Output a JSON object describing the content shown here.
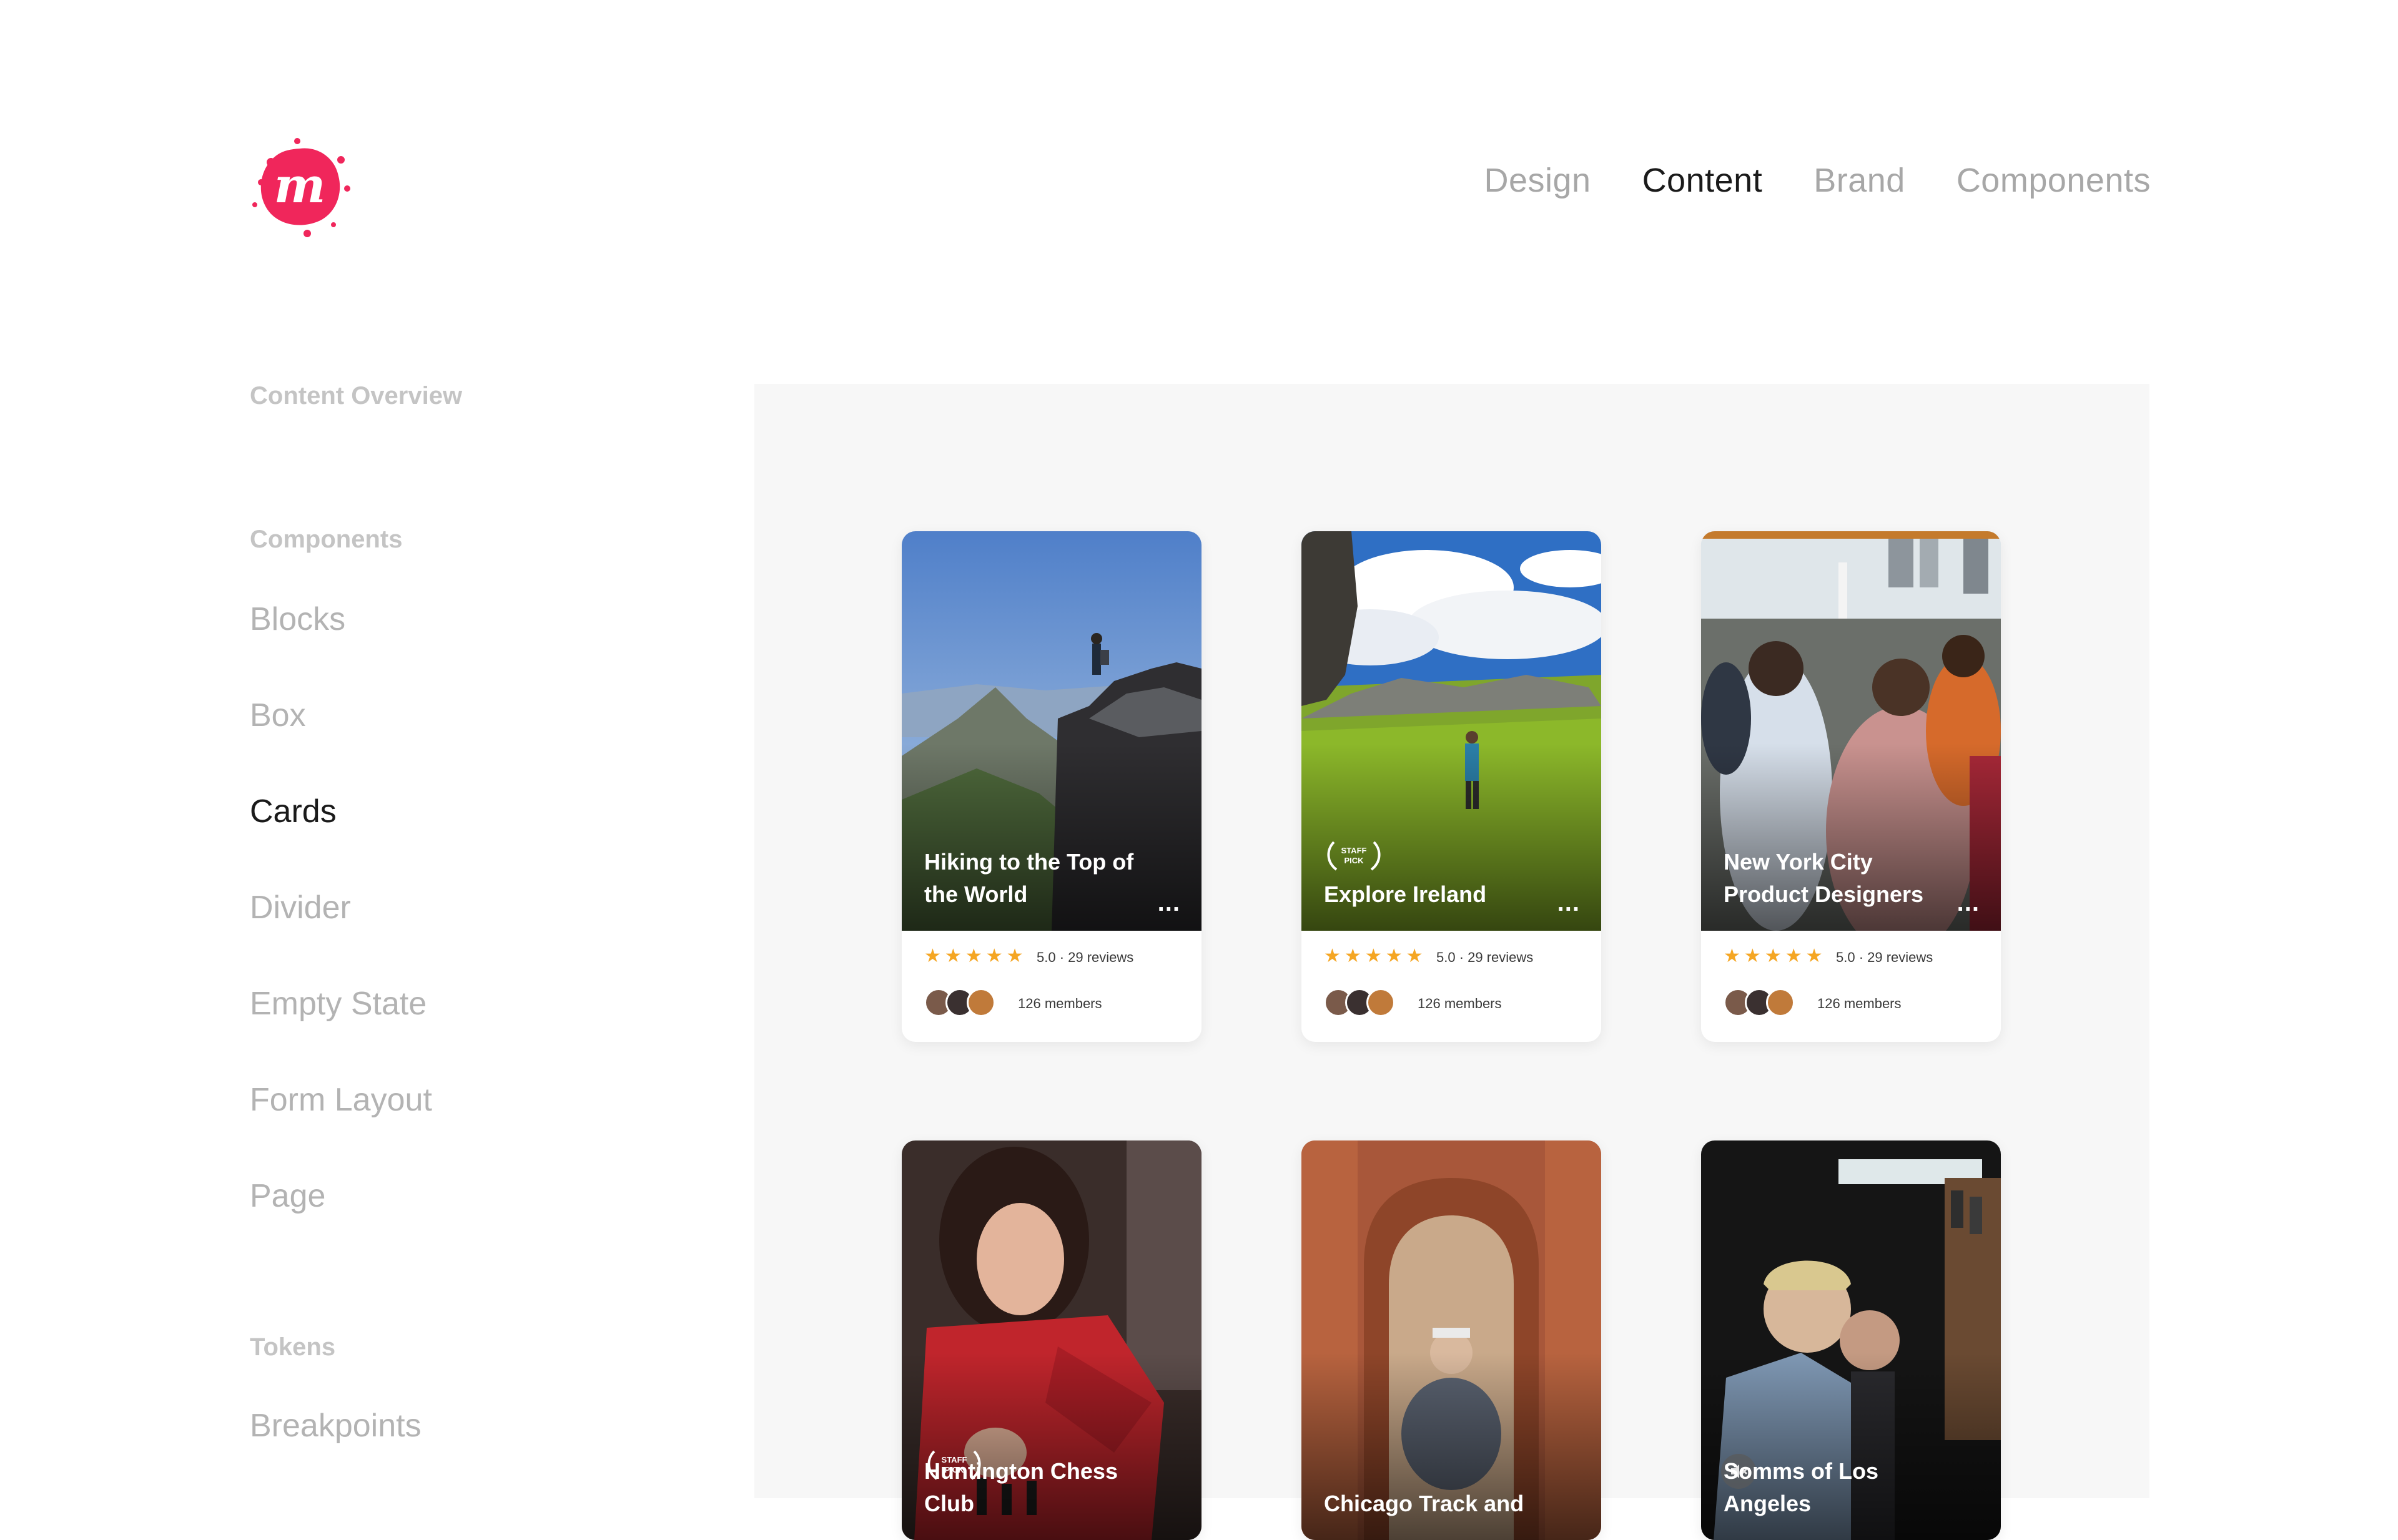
{
  "nav": {
    "logo_alt": "m",
    "items": [
      {
        "label": "Design",
        "active": false
      },
      {
        "label": "Content",
        "active": true
      },
      {
        "label": "Brand",
        "active": false
      },
      {
        "label": "Components",
        "active": false
      }
    ]
  },
  "sidebar": {
    "overview": "Content Overview",
    "components_heading": "Components",
    "items": [
      "Blocks",
      "Box",
      "Cards",
      "Divider",
      "Empty State",
      "Form Layout",
      "Page"
    ],
    "active_item": "Cards",
    "tokens_heading": "Tokens",
    "token_items": [
      "Breakpoints"
    ]
  },
  "cards": [
    {
      "title": "Hiking to the Top of the World",
      "staff_pick": false,
      "more": "...",
      "rating": 5,
      "rating_text": "5.0 · 29 reviews",
      "members": "126 members"
    },
    {
      "title": "Explore Ireland",
      "staff_pick": true,
      "more": "...",
      "rating": 5,
      "rating_text": "5.0 · 29 reviews",
      "members": "126 members"
    },
    {
      "title": "New York City Product Designers",
      "staff_pick": false,
      "more": "...",
      "rating": 5,
      "rating_text": "5.0 · 29 reviews",
      "members": "126 members"
    },
    {
      "title": "Huntington Chess Club",
      "staff_pick": true
    },
    {
      "title": "Chicago Track and",
      "staff_pick": false
    },
    {
      "title": "Somms of Los Angeles",
      "staff_pick": false,
      "muted_video": true
    }
  ],
  "staff_pick_label": [
    "STAFF",
    "PICK"
  ],
  "colors": {
    "brand": "#f0265b",
    "star": "#f5a623",
    "active_text": "#1a1a1a",
    "muted_text": "#a7a7a7",
    "panel": "#f7f7f7"
  }
}
